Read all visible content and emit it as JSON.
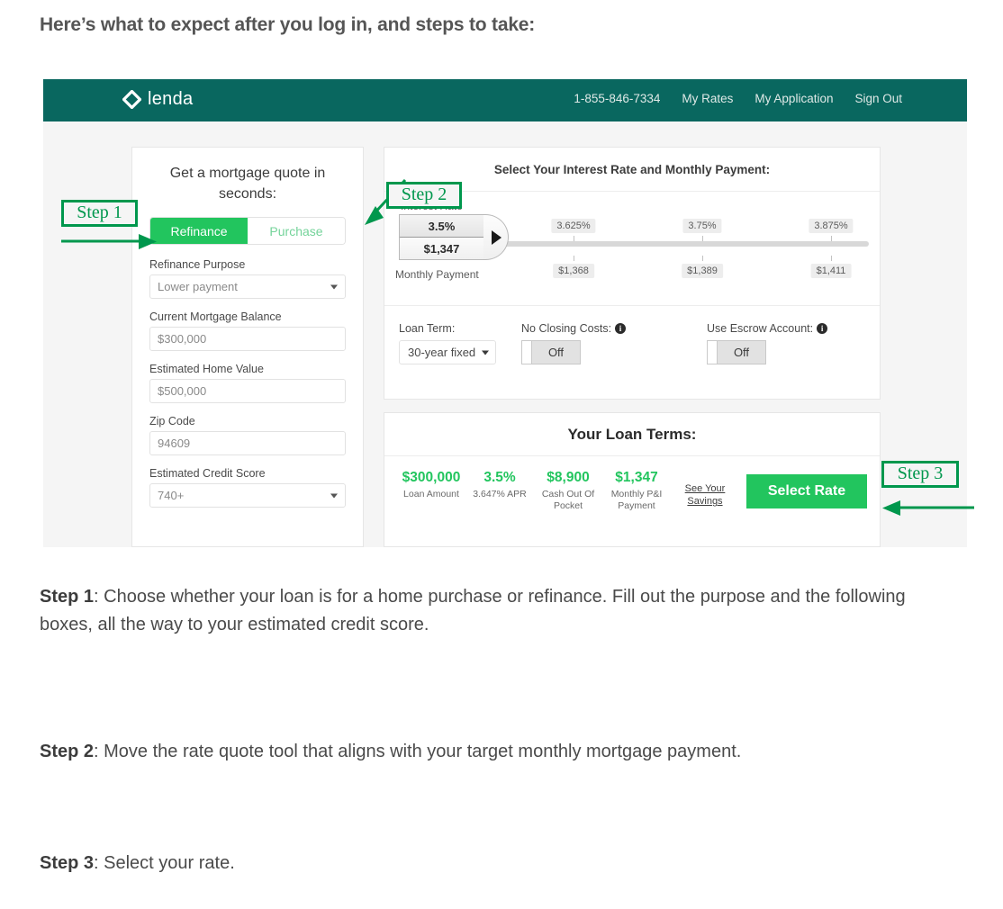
{
  "page": {
    "heading": "Here’s what to expect after you log in, and steps to take:"
  },
  "app": {
    "logo_text": "lenda",
    "nav": [
      {
        "label": "1-855-846-7334"
      },
      {
        "label": "My Rates"
      },
      {
        "label": "My Application"
      },
      {
        "label": "Sign Out"
      }
    ],
    "quote_form": {
      "title": "Get a mortgage quote in seconds:",
      "segmented": {
        "active": "Refinance",
        "inactive": "Purchase"
      },
      "fields": [
        {
          "label": "Refinance Purpose",
          "value": "Lower payment",
          "type": "select"
        },
        {
          "label": "Current Mortgage Balance",
          "value": "$300,000",
          "type": "text"
        },
        {
          "label": "Estimated Home Value",
          "value": "$500,000",
          "type": "text"
        },
        {
          "label": "Zip Code",
          "value": "94609",
          "type": "text"
        },
        {
          "label": "Estimated Credit Score",
          "value": "740+",
          "type": "select"
        }
      ]
    },
    "rate_card": {
      "title": "Select Your Interest Rate and Monthly Payment:",
      "interest_rate_label": "Interest Rate",
      "monthly_payment_label": "Monthly Payment",
      "handle": {
        "rate": "3.5%",
        "payment": "$1,347"
      },
      "ticks": [
        {
          "rate": "3.625%",
          "payment": "$1,368"
        },
        {
          "rate": "3.75%",
          "payment": "$1,389"
        },
        {
          "rate": "3.875%",
          "payment": "$1,411"
        }
      ],
      "controls": {
        "loan_term_label": "Loan Term:",
        "loan_term_value": "30-year fixed",
        "no_closing_costs_label": "No Closing Costs:",
        "no_closing_costs_value": "Off",
        "use_escrow_label": "Use Escrow Account:",
        "use_escrow_value": "Off"
      }
    },
    "loan_terms": {
      "title": "Your Loan Terms:",
      "items": [
        {
          "value": "$300,000",
          "label": "Loan Amount"
        },
        {
          "value": "3.5%",
          "label": "3.647% APR"
        },
        {
          "value": "$8,900",
          "label": "Cash Out Of Pocket"
        },
        {
          "value": "$1,347",
          "label": "Monthly P&I Payment"
        }
      ],
      "savings_link": "See Your Savings",
      "select_rate_button": "Select Rate"
    }
  },
  "annotations": {
    "step1": "Step 1",
    "step2": "Step 2",
    "step3": "Step 3",
    "accent_color": "#00974d"
  },
  "instructions": [
    {
      "step": "Step 1",
      "text": ": Choose whether your loan is for a home purchase or refinance. Fill out the purpose and the following boxes, all the way to your estimated credit score."
    },
    {
      "step": "Step 2",
      "text": ": Move the rate quote tool that aligns with your target monthly mortgage payment."
    },
    {
      "step": "Step 3",
      "text": ": Select your rate."
    }
  ],
  "colors": {
    "header_teal": "#09675f",
    "brand_green": "#22c55e",
    "annotation_green": "#00974d"
  }
}
